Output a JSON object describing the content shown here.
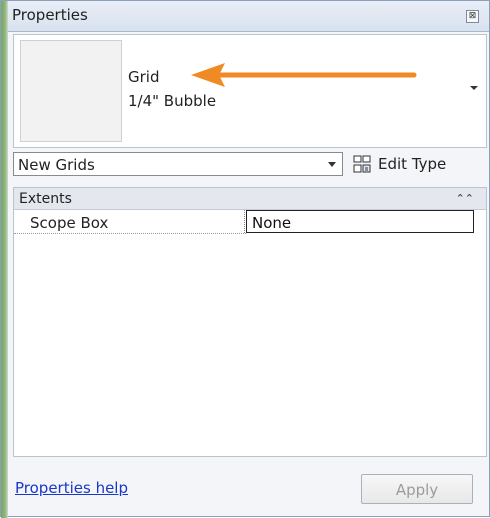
{
  "panel": {
    "title": "Properties"
  },
  "type_selector": {
    "family": "Grid",
    "type": "1/4\" Bubble"
  },
  "filter": {
    "selected": "New Grids",
    "edit_type_label": "Edit Type"
  },
  "properties": {
    "group": "Extents",
    "rows": [
      {
        "name": "Scope Box",
        "value": "None"
      }
    ]
  },
  "footer": {
    "help_link": "Properties help",
    "apply_label": "Apply",
    "apply_enabled": false
  },
  "colors": {
    "callout_arrow": "#f08a24",
    "link": "#1a37c8"
  },
  "icons": {
    "close": "close-icon",
    "selector_dropdown": "chevron-down-icon",
    "filter_dropdown": "chevron-down-icon",
    "edit_type": "edit-type-icon",
    "collapse": "collapse-icon"
  }
}
